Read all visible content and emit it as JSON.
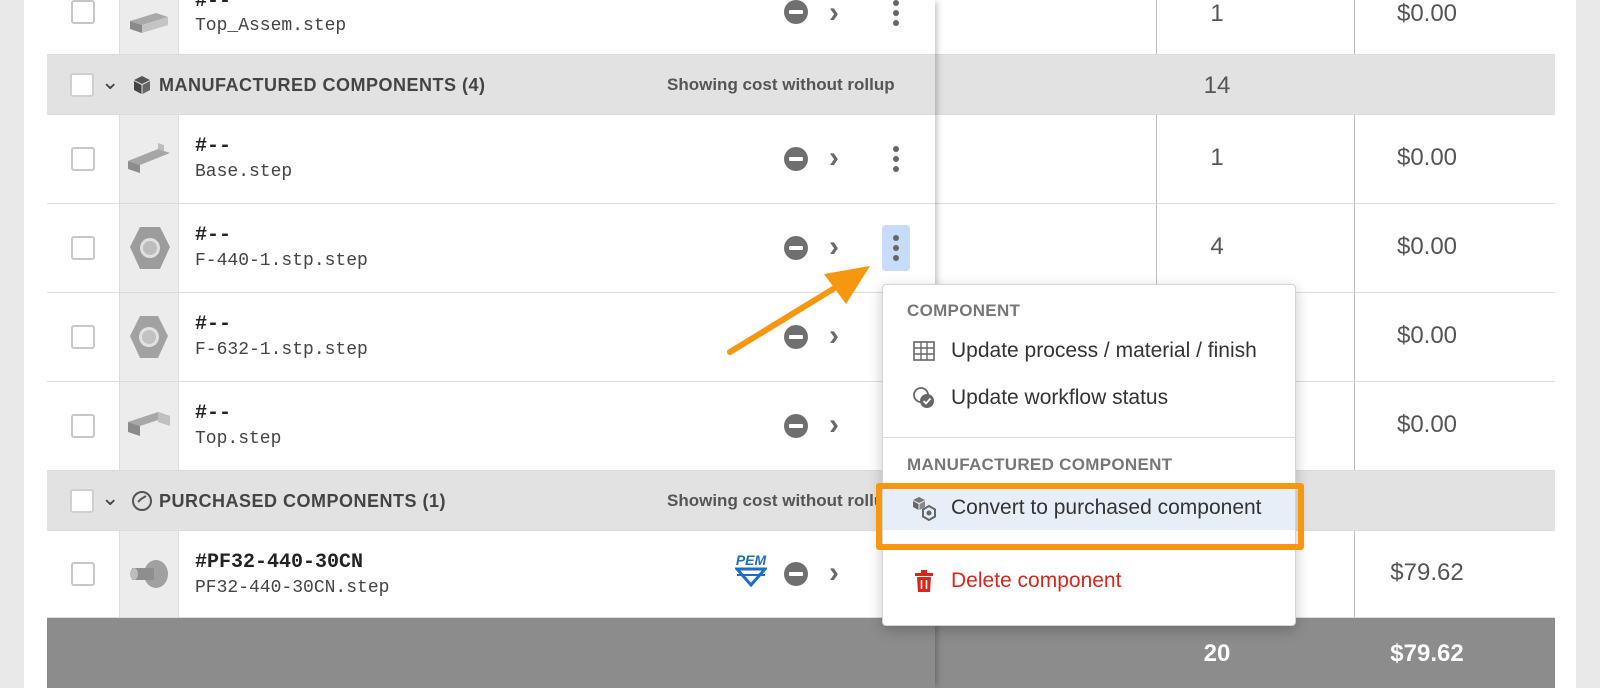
{
  "rows_top": {
    "partial_row": {
      "part_number": "#--",
      "file": "Top_Assem.step",
      "qty": "1",
      "cost": "$0.00"
    }
  },
  "groups": {
    "manufactured": {
      "title": "MANUFACTURED COMPONENTS (4)",
      "note": "Showing cost without rollup",
      "qty": "14"
    },
    "purchased": {
      "title": "PURCHASED COMPONENTS (1)",
      "note": "Showing cost without rollup"
    }
  },
  "rows": [
    {
      "part_number": "#--",
      "file": "Base.step",
      "qty": "1",
      "cost": "$0.00"
    },
    {
      "part_number": "#--",
      "file": "F-440-1.stp.step",
      "qty": "4",
      "cost": "$0.00"
    },
    {
      "part_number": "#--",
      "file": "F-632-1.stp.step",
      "qty": "",
      "cost": "$0.00"
    },
    {
      "part_number": "#--",
      "file": "Top.step",
      "qty": "",
      "cost": "$0.00"
    }
  ],
  "purchased_row": {
    "part_number": "#PF32-440-30CN",
    "file": "PF32-440-30CN.step",
    "brand_badge": "PEM",
    "qty": "",
    "cost": "$79.62"
  },
  "footer": {
    "qty": "20",
    "cost": "$79.62"
  },
  "menu": {
    "section_component": "COMPONENT",
    "item_update_process": "Update process / material / finish",
    "item_update_workflow": "Update workflow status",
    "section_manufactured": "MANUFACTURED COMPONENT",
    "item_convert": "Convert to purchased component",
    "item_delete": "Delete component"
  },
  "colors": {
    "highlight": "#f7960f",
    "delete": "#d9261c",
    "active_kebab": "#c6dcfa"
  }
}
